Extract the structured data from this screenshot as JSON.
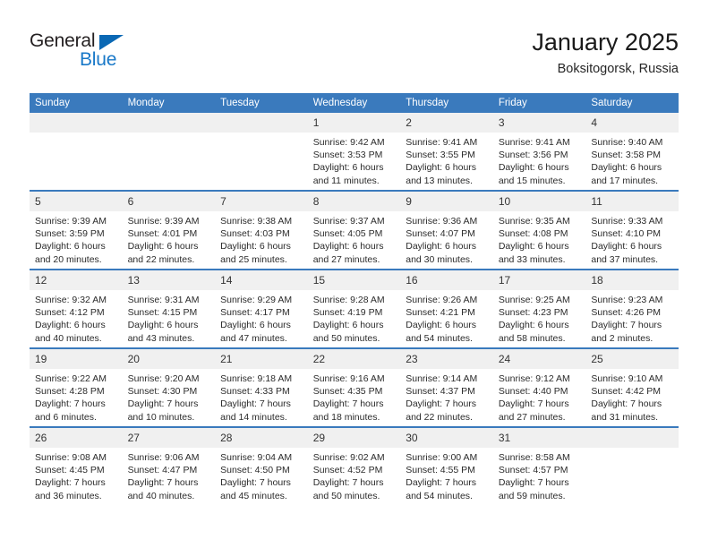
{
  "logo": {
    "word1": "General",
    "word2": "Blue",
    "triangle_color": "#0a68b4",
    "blue_color": "#1878c8"
  },
  "header": {
    "title": "January 2025",
    "subtitle": "Boksitogorsk, Russia"
  },
  "theme": {
    "header_blue": "#3a7abd",
    "daynum_band": "#f0f0f0",
    "text": "#2b2b2b"
  },
  "weekday_headers": [
    "Sunday",
    "Monday",
    "Tuesday",
    "Wednesday",
    "Thursday",
    "Friday",
    "Saturday"
  ],
  "weeks": [
    [
      {
        "day": "",
        "empty": true
      },
      {
        "day": "",
        "empty": true
      },
      {
        "day": "",
        "empty": true
      },
      {
        "day": "1",
        "sunrise": "Sunrise: 9:42 AM",
        "sunset": "Sunset: 3:53 PM",
        "daylight1": "Daylight: 6 hours",
        "daylight2": "and 11 minutes."
      },
      {
        "day": "2",
        "sunrise": "Sunrise: 9:41 AM",
        "sunset": "Sunset: 3:55 PM",
        "daylight1": "Daylight: 6 hours",
        "daylight2": "and 13 minutes."
      },
      {
        "day": "3",
        "sunrise": "Sunrise: 9:41 AM",
        "sunset": "Sunset: 3:56 PM",
        "daylight1": "Daylight: 6 hours",
        "daylight2": "and 15 minutes."
      },
      {
        "day": "4",
        "sunrise": "Sunrise: 9:40 AM",
        "sunset": "Sunset: 3:58 PM",
        "daylight1": "Daylight: 6 hours",
        "daylight2": "and 17 minutes."
      }
    ],
    [
      {
        "day": "5",
        "sunrise": "Sunrise: 9:39 AM",
        "sunset": "Sunset: 3:59 PM",
        "daylight1": "Daylight: 6 hours",
        "daylight2": "and 20 minutes."
      },
      {
        "day": "6",
        "sunrise": "Sunrise: 9:39 AM",
        "sunset": "Sunset: 4:01 PM",
        "daylight1": "Daylight: 6 hours",
        "daylight2": "and 22 minutes."
      },
      {
        "day": "7",
        "sunrise": "Sunrise: 9:38 AM",
        "sunset": "Sunset: 4:03 PM",
        "daylight1": "Daylight: 6 hours",
        "daylight2": "and 25 minutes."
      },
      {
        "day": "8",
        "sunrise": "Sunrise: 9:37 AM",
        "sunset": "Sunset: 4:05 PM",
        "daylight1": "Daylight: 6 hours",
        "daylight2": "and 27 minutes."
      },
      {
        "day": "9",
        "sunrise": "Sunrise: 9:36 AM",
        "sunset": "Sunset: 4:07 PM",
        "daylight1": "Daylight: 6 hours",
        "daylight2": "and 30 minutes."
      },
      {
        "day": "10",
        "sunrise": "Sunrise: 9:35 AM",
        "sunset": "Sunset: 4:08 PM",
        "daylight1": "Daylight: 6 hours",
        "daylight2": "and 33 minutes."
      },
      {
        "day": "11",
        "sunrise": "Sunrise: 9:33 AM",
        "sunset": "Sunset: 4:10 PM",
        "daylight1": "Daylight: 6 hours",
        "daylight2": "and 37 minutes."
      }
    ],
    [
      {
        "day": "12",
        "sunrise": "Sunrise: 9:32 AM",
        "sunset": "Sunset: 4:12 PM",
        "daylight1": "Daylight: 6 hours",
        "daylight2": "and 40 minutes."
      },
      {
        "day": "13",
        "sunrise": "Sunrise: 9:31 AM",
        "sunset": "Sunset: 4:15 PM",
        "daylight1": "Daylight: 6 hours",
        "daylight2": "and 43 minutes."
      },
      {
        "day": "14",
        "sunrise": "Sunrise: 9:29 AM",
        "sunset": "Sunset: 4:17 PM",
        "daylight1": "Daylight: 6 hours",
        "daylight2": "and 47 minutes."
      },
      {
        "day": "15",
        "sunrise": "Sunrise: 9:28 AM",
        "sunset": "Sunset: 4:19 PM",
        "daylight1": "Daylight: 6 hours",
        "daylight2": "and 50 minutes."
      },
      {
        "day": "16",
        "sunrise": "Sunrise: 9:26 AM",
        "sunset": "Sunset: 4:21 PM",
        "daylight1": "Daylight: 6 hours",
        "daylight2": "and 54 minutes."
      },
      {
        "day": "17",
        "sunrise": "Sunrise: 9:25 AM",
        "sunset": "Sunset: 4:23 PM",
        "daylight1": "Daylight: 6 hours",
        "daylight2": "and 58 minutes."
      },
      {
        "day": "18",
        "sunrise": "Sunrise: 9:23 AM",
        "sunset": "Sunset: 4:26 PM",
        "daylight1": "Daylight: 7 hours",
        "daylight2": "and 2 minutes."
      }
    ],
    [
      {
        "day": "19",
        "sunrise": "Sunrise: 9:22 AM",
        "sunset": "Sunset: 4:28 PM",
        "daylight1": "Daylight: 7 hours",
        "daylight2": "and 6 minutes."
      },
      {
        "day": "20",
        "sunrise": "Sunrise: 9:20 AM",
        "sunset": "Sunset: 4:30 PM",
        "daylight1": "Daylight: 7 hours",
        "daylight2": "and 10 minutes."
      },
      {
        "day": "21",
        "sunrise": "Sunrise: 9:18 AM",
        "sunset": "Sunset: 4:33 PM",
        "daylight1": "Daylight: 7 hours",
        "daylight2": "and 14 minutes."
      },
      {
        "day": "22",
        "sunrise": "Sunrise: 9:16 AM",
        "sunset": "Sunset: 4:35 PM",
        "daylight1": "Daylight: 7 hours",
        "daylight2": "and 18 minutes."
      },
      {
        "day": "23",
        "sunrise": "Sunrise: 9:14 AM",
        "sunset": "Sunset: 4:37 PM",
        "daylight1": "Daylight: 7 hours",
        "daylight2": "and 22 minutes."
      },
      {
        "day": "24",
        "sunrise": "Sunrise: 9:12 AM",
        "sunset": "Sunset: 4:40 PM",
        "daylight1": "Daylight: 7 hours",
        "daylight2": "and 27 minutes."
      },
      {
        "day": "25",
        "sunrise": "Sunrise: 9:10 AM",
        "sunset": "Sunset: 4:42 PM",
        "daylight1": "Daylight: 7 hours",
        "daylight2": "and 31 minutes."
      }
    ],
    [
      {
        "day": "26",
        "sunrise": "Sunrise: 9:08 AM",
        "sunset": "Sunset: 4:45 PM",
        "daylight1": "Daylight: 7 hours",
        "daylight2": "and 36 minutes."
      },
      {
        "day": "27",
        "sunrise": "Sunrise: 9:06 AM",
        "sunset": "Sunset: 4:47 PM",
        "daylight1": "Daylight: 7 hours",
        "daylight2": "and 40 minutes."
      },
      {
        "day": "28",
        "sunrise": "Sunrise: 9:04 AM",
        "sunset": "Sunset: 4:50 PM",
        "daylight1": "Daylight: 7 hours",
        "daylight2": "and 45 minutes."
      },
      {
        "day": "29",
        "sunrise": "Sunrise: 9:02 AM",
        "sunset": "Sunset: 4:52 PM",
        "daylight1": "Daylight: 7 hours",
        "daylight2": "and 50 minutes."
      },
      {
        "day": "30",
        "sunrise": "Sunrise: 9:00 AM",
        "sunset": "Sunset: 4:55 PM",
        "daylight1": "Daylight: 7 hours",
        "daylight2": "and 54 minutes."
      },
      {
        "day": "31",
        "sunrise": "Sunrise: 8:58 AM",
        "sunset": "Sunset: 4:57 PM",
        "daylight1": "Daylight: 7 hours",
        "daylight2": "and 59 minutes."
      },
      {
        "day": "",
        "empty": true
      }
    ]
  ]
}
